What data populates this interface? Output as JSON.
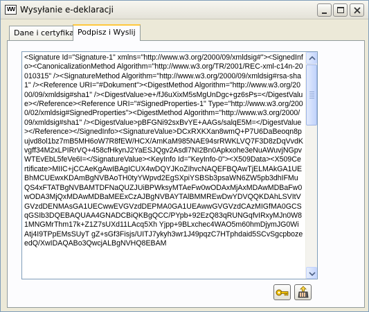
{
  "window": {
    "title": "Wysyłanie e-deklaracji",
    "app_icon_text": "VVV"
  },
  "tabs": [
    {
      "label": "Dane i certyfikaty",
      "active": false
    },
    {
      "label": "Podpisz i Wyslij",
      "active": true
    }
  ],
  "signature_xml": "<Signature Id=\"Signature-1\" xmlns=\"http://www.w3.org/2000/09/xmldsig#\"><SignedInfo><CanonicalizationMethod Algorithm=\"http://www.w3.org/TR/2001/REC-xml-c14n-20010315\" /><SignatureMethod Algorithm=\"http://www.w3.org/2000/09/xmldsig#rsa-sha1\" /><Reference URI=\"#Dokument\"><DigestMethod Algorithm=\"http://www.w3.org/2000/09/xmldsig#sha1\" /><DigestValue>e+/fJ6uXixM5sMgUnDgc+gz6sPs=</DigestValue></Reference><Reference URI=\"#SignedProperties-1\" Type=\"http://www.w3.org/2000/02/xmldsig#SignedProperties\"><DigestMethod Algorithm=\"http://www.w3.org/2000/09/xmldsig#sha1\" /><DigestValue>pBFGNi92sxBvYE+AAGs/salqE5M=</DigestValue></Reference></SignedInfo><SignatureValue>DCxRXKXan8wmQ+P7U6DaBeoqn8pujvd8ol1bz7mB5MH6oW7R8fEW/HCX/AmKaM985NAE94srRWKLVQ7F3D8zDqVvdKvgff34M2xLPIRrVQ+458cfHkynJ2YaESJQgv2Asdl7NI2Bn0Apkxohe3eNuAWuvjNGpvWTEvEbL5feVe6I=</SignatureValue><KeyInfo Id=\"KeyInfo-0\"><X509Data><X509Certificate>MIIC+jCCAeKgAwIBAgICUX4wDQYJKoZIhvcNAQEFBQAwTjELMAkGA1UEBhMCUEwxKDAmBgNVBAoTH0tyYWpvd2EgSXpiYSBSb3psaWN6ZW5pb3dhIFMuQS4xFTATBgNVBAMTDFNaQUZJUiBPWksyMTAeFw0wODAxMjAxMDAwMDBaFw0wODA3MjQxMDAwMDBaMEExCzAJBgNVBAYTAlBMMREwDwYDVQQKDAhLSVItVGVzdDENMAsGA1UECwwEVGVzdDEPMA0GA1UEAwwGVGVzdCAzMIGfMA0GCSqGSIb3DQEBAQUAA4GNADCBiQKBgQCC/PYpb+92EzQ83qRUNGqfvIRxyMJn0W81MNGMrThm17k+Z1Z7sUXd11LAcq5Xh Yjpp+9BLxchec4WAO5m60hmDjymJG0WiAtj4I9TPpEMsSUyT gZ+sGf3Fisjs/UITJ7ykyh3wr1J49pqzC7HTphdaid5SCvSgcpbozeedQ/XwIDAQABo3QwcjALBgNVHQ8EBAM"
}
